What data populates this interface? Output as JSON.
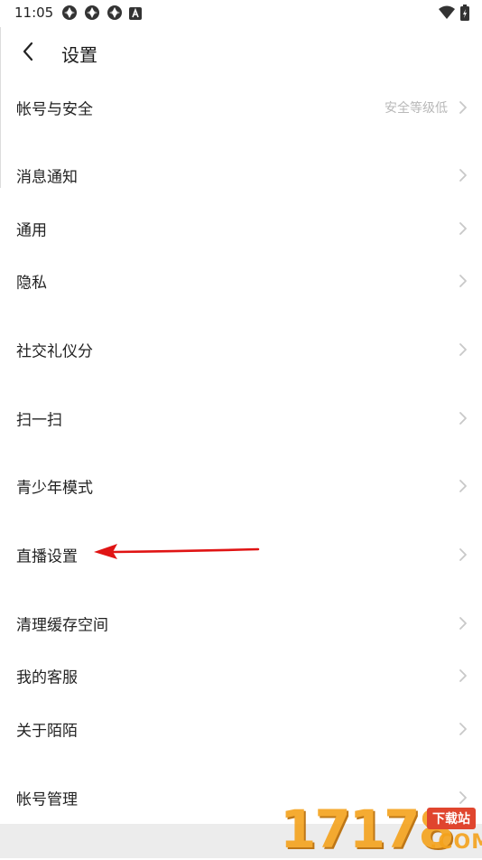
{
  "status_bar": {
    "time": "11:05",
    "left_icons": [
      "app-notification-icon",
      "app-notification-icon",
      "app-notification-icon",
      "text-a-icon"
    ],
    "right_icons": [
      "wifi-icon",
      "battery-icon"
    ]
  },
  "header": {
    "title": "设置",
    "back_icon": "chevron-left-icon"
  },
  "settings": {
    "account_security": {
      "label": "帐号与安全",
      "secondary": "安全等级低"
    },
    "notifications": {
      "label": "消息通知"
    },
    "general": {
      "label": "通用"
    },
    "privacy": {
      "label": "隐私"
    },
    "social_etiquette": {
      "label": "社交礼仪分"
    },
    "scan": {
      "label": "扫一扫"
    },
    "teen_mode": {
      "label": "青少年模式"
    },
    "live_settings": {
      "label": "直播设置"
    },
    "clear_cache": {
      "label": "清理缓存空间"
    },
    "customer_service": {
      "label": "我的客服"
    },
    "about": {
      "label": "关于陌陌"
    },
    "account_management": {
      "label": "帐号管理"
    }
  },
  "annotation": {
    "color": "#e01414"
  },
  "watermark": {
    "number": "17178",
    "tag": "下载站",
    "suffix": ".COM"
  },
  "colors": {
    "background": "#ffffff",
    "text_primary": "#222222",
    "text_secondary": "#b8b8b8",
    "chevron": "#c8c8c8",
    "bottom_bar": "#ececec"
  }
}
